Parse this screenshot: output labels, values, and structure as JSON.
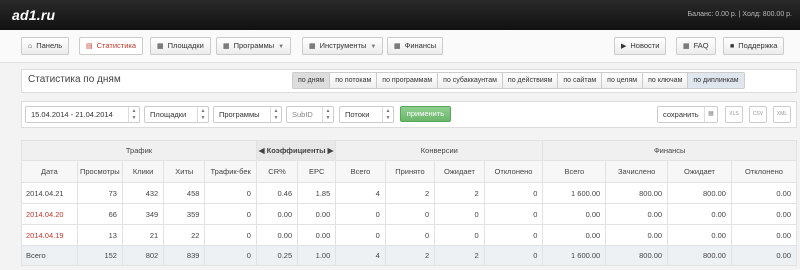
{
  "header": {
    "logo": "ad1.ru",
    "balance": "Баланс: 0.00 р. | Холд: 800.00 р."
  },
  "nav": {
    "panel": "Панель",
    "stats": "Статистика",
    "sites": "Площадки",
    "programs": "Программы",
    "tools": "Инструменты",
    "finance": "Финансы",
    "news": "Новости",
    "faq": "FAQ",
    "support": "Поддержка"
  },
  "page": {
    "title": "Статистика по дням"
  },
  "tabs": [
    "по дням",
    "по потокам",
    "по программам",
    "по субаккаунтам",
    "по действиям",
    "по сайтам",
    "по целям",
    "по ключам",
    "по диплинкам"
  ],
  "filters": {
    "date_range": "15.04.2014 - 21.04.2014",
    "sites": "Площадки",
    "programs": "Программы",
    "subid": "SubID",
    "streams": "Потоки",
    "apply": "применить",
    "save": "сохранить",
    "xls": "XLS",
    "csv": "CSV",
    "xml": "XML"
  },
  "table": {
    "groups": {
      "traffic": "Трафик",
      "coefficients": "Коэффициенты",
      "conversions": "Конверсии",
      "finance": "Финансы"
    },
    "columns": [
      "Дата",
      "Просмотры",
      "Клики",
      "Хиты",
      "Трафик-бек",
      "CR%",
      "EPC",
      "Всего",
      "Принято",
      "Ожидает",
      "Отклонено",
      "Всего",
      "Зачислено",
      "Ожидает",
      "Отклонено"
    ],
    "rows": [
      [
        "2014.04.21",
        "73",
        "432",
        "458",
        "0",
        "0.46",
        "1.85",
        "4",
        "2",
        "2",
        "0",
        "1 600.00",
        "800.00",
        "800.00",
        "0.00"
      ],
      [
        "2014.04.20",
        "66",
        "349",
        "359",
        "0",
        "0.00",
        "0.00",
        "0",
        "0",
        "0",
        "0",
        "0.00",
        "0.00",
        "0.00",
        "0.00"
      ],
      [
        "2014.04.19",
        "13",
        "21",
        "22",
        "0",
        "0.00",
        "0.00",
        "0",
        "0",
        "0",
        "0",
        "0.00",
        "0.00",
        "0.00",
        "0.00"
      ]
    ],
    "total": [
      "Всего",
      "152",
      "802",
      "839",
      "0",
      "0.25",
      "1.00",
      "4",
      "2",
      "2",
      "0",
      "1 600.00",
      "800.00",
      "800.00",
      "0.00"
    ]
  },
  "colors": {
    "accent": "#c0392b",
    "apply": "#6bb56b",
    "topbar": "#1a1a1a"
  }
}
